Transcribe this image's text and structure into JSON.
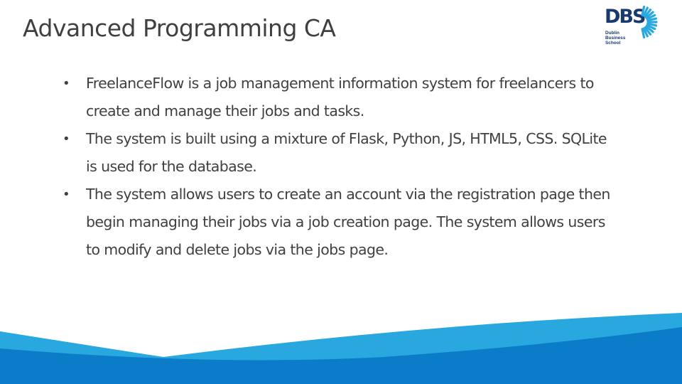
{
  "slide": {
    "title": "Advanced Programming CA",
    "bullets": [
      "FreelanceFlow is a job management information system for freelancers to create and manage their jobs and tasks.",
      "The system is built using a mixture of Flask, Python, JS, HTML5, CSS. SQLite is used for the database.",
      "The system allows users to create an account via the registration page then begin managing their jobs via a job creation page. The system allows users to modify and delete jobs via the jobs page."
    ],
    "bullet_symbol": "•"
  },
  "logo": {
    "wordmark": "DBS",
    "subtitle_lines": [
      "Dublin",
      "Business",
      "School"
    ],
    "colors": {
      "navy": "#1a3a6e",
      "blue": "#29a8e0"
    }
  },
  "footer": {
    "colors": {
      "light_blue": "#29a8e0",
      "dark_blue": "#0b7cc8"
    }
  }
}
